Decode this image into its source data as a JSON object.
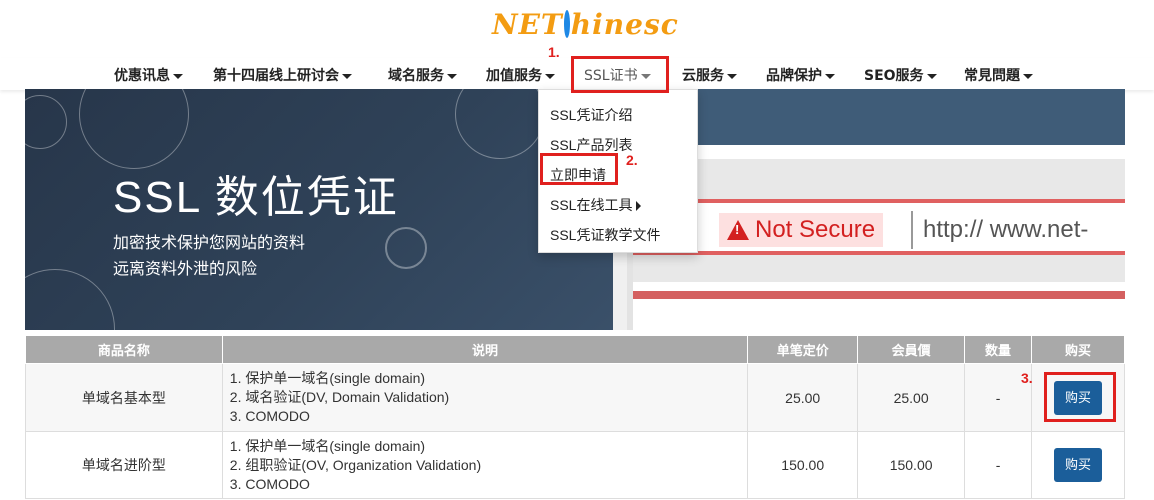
{
  "logo": {
    "text_left": "NET",
    "text_right": "hinesc"
  },
  "nav": {
    "items": [
      {
        "label": "优惠讯息"
      },
      {
        "label": "第十四届线上研讨会"
      },
      {
        "label": "域名服务"
      },
      {
        "label": "加值服务"
      },
      {
        "label": "SSL证书"
      },
      {
        "label": "云服务"
      },
      {
        "label": "品牌保护"
      },
      {
        "label": "SEO服务"
      },
      {
        "label": "常見問題"
      }
    ]
  },
  "steps": {
    "s1": "1.",
    "s2": "2.",
    "s3": "3."
  },
  "dropdown": {
    "items": [
      {
        "label": "SSL凭证介绍"
      },
      {
        "label": "SSL产品列表"
      },
      {
        "label": "立即申请"
      },
      {
        "label": "SSL在线工具"
      },
      {
        "label": "SSL凭证教学文件"
      }
    ]
  },
  "banner": {
    "title": "SSL 数位凭证",
    "sub1": "加密技术保护您网站的资料",
    "sub2": "远离资料外泄的风险",
    "not_secure": "Not Secure",
    "url": "http:// www.net-"
  },
  "table": {
    "headers": [
      "商品名称",
      "说明",
      "单笔定价",
      "会員價",
      "数量",
      "购买"
    ],
    "rows": [
      {
        "name": "单域名基本型",
        "desc": [
          "1. 保护单一域名(single domain)",
          "2. 域名验证(DV, Domain Validation)",
          "3. COMODO"
        ],
        "price": "25.00",
        "member_price": "25.00",
        "qty": "-",
        "buy": "购买"
      },
      {
        "name": "单域名进阶型",
        "desc": [
          "1. 保护单一域名(single domain)",
          "2. 组职验证(OV, Organization Validation)",
          "3. COMODO"
        ],
        "price": "150.00",
        "member_price": "150.00",
        "qty": "-",
        "buy": "购买"
      }
    ]
  },
  "colors": {
    "highlight": "#e0201e",
    "buy_button": "#1b5e9a",
    "table_header": "#a9a9a9"
  }
}
